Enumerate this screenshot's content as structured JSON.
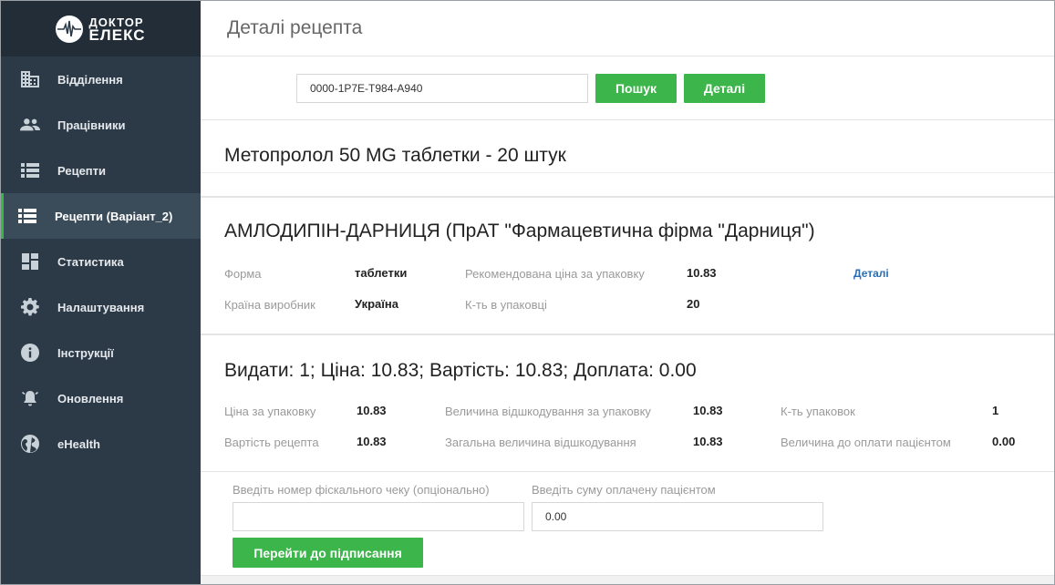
{
  "brand": {
    "line1": "ДОКТОР",
    "line2": "ЕЛЕКС"
  },
  "sidebar": {
    "items": [
      {
        "label": "Відділення",
        "icon": "building-icon"
      },
      {
        "label": "Працівники",
        "icon": "people-icon"
      },
      {
        "label": "Рецепти",
        "icon": "list-icon"
      },
      {
        "label": "Рецепти (Варіант_2)",
        "icon": "list-icon",
        "active": true
      },
      {
        "label": "Статистика",
        "icon": "dashboard-icon"
      },
      {
        "label": "Налаштування",
        "icon": "gear-icon"
      },
      {
        "label": "Інструкції",
        "icon": "info-icon"
      },
      {
        "label": "Оновлення",
        "icon": "bell-icon"
      },
      {
        "label": "eHealth",
        "icon": "globe-icon"
      }
    ]
  },
  "page": {
    "title": "Деталі рецепта"
  },
  "search": {
    "value": "0000-1P7E-T984-A940",
    "search_label": "Пошук",
    "details_label": "Деталі"
  },
  "prescription": {
    "title": "Метопролол 50 MG таблетки - 20 штук"
  },
  "drug": {
    "title": "АМЛОДИПІН-ДАРНИЦЯ (ПрАТ \"Фармацевтична фірма \"Дарниця\")",
    "form_label": "Форма",
    "form_value": "таблетки",
    "price_label": "Рекомендована ціна за упаковку",
    "price_value": "10.83",
    "details_link": "Деталі",
    "country_label": "Країна виробник",
    "country_value": "Україна",
    "qty_label": "К-ть в упаковці",
    "qty_value": "20"
  },
  "dispense": {
    "title": "Видати: 1; Ціна: 10.83; Вартість: 10.83; Доплата: 0.00",
    "pack_price_label": "Ціна за упаковку",
    "pack_price_value": "10.83",
    "reimb_pack_label": "Величина відшкодування за упаковку",
    "reimb_pack_value": "10.83",
    "packs_label": "К-ть упаковок",
    "packs_value": "1",
    "rx_cost_label": "Вартість рецепта",
    "rx_cost_value": "10.83",
    "reimb_total_label": "Загальна величина відшкодування",
    "reimb_total_value": "10.83",
    "patient_pay_label": "Величина до оплати пацієнтом",
    "patient_pay_value": "0.00"
  },
  "payment": {
    "receipt_label": "Введіть номер фіскального чеку (опціонально)",
    "receipt_value": "",
    "amount_label": "Введіть суму оплачену пацієнтом",
    "amount_value": "0.00",
    "sign_label": "Перейти до підписання"
  },
  "colors": {
    "accent": "#3cb54a",
    "sidebar": "#2c3a47",
    "link": "#2a6db4"
  }
}
